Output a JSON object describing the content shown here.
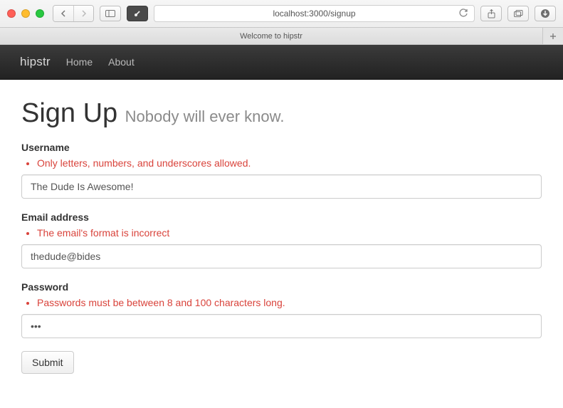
{
  "browser": {
    "url": "localhost:3000/signup",
    "tab_title": "Welcome to hipstr"
  },
  "navbar": {
    "brand": "hipstr",
    "links": [
      "Home",
      "About"
    ]
  },
  "page": {
    "heading": "Sign Up",
    "subtitle": "Nobody will ever know."
  },
  "form": {
    "username": {
      "label": "Username",
      "error": "Only letters, numbers, and underscores allowed.",
      "value": "The Dude Is Awesome!"
    },
    "email": {
      "label": "Email address",
      "error": "The email's format is incorrect",
      "value": "thedude@bides"
    },
    "password": {
      "label": "Password",
      "error": "Passwords must be between 8 and 100 characters long.",
      "value": "•••"
    },
    "submit_label": "Submit"
  }
}
